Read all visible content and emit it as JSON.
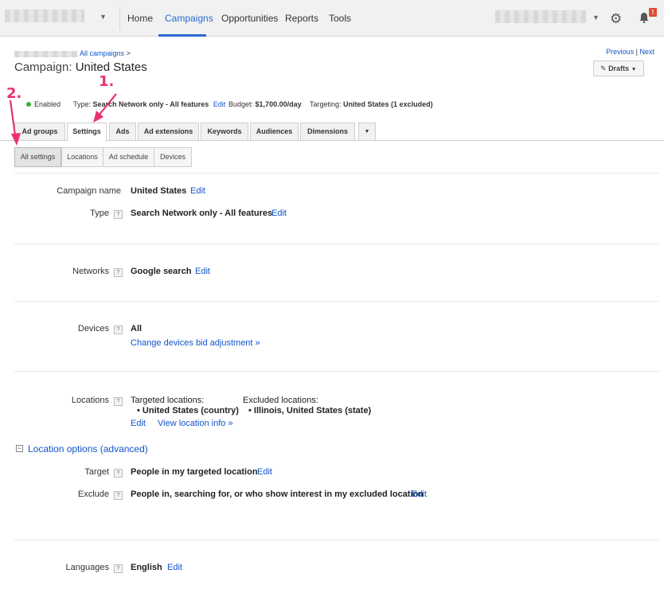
{
  "nav": {
    "items": [
      "Home",
      "Campaigns",
      "Opportunities",
      "Reports",
      "Tools"
    ],
    "active": "Campaigns",
    "notification_badge": "!"
  },
  "header": {
    "breadcrumb_link": "All campaigns",
    "breadcrumb_sep": ">",
    "title_prefix": "Campaign:",
    "title": "United States",
    "previous": "Previous",
    "next": "Next",
    "pager_sep": "|",
    "drafts": "Drafts"
  },
  "status": {
    "state": "Enabled",
    "type_label": "Type:",
    "type_value": "Search Network only - All features",
    "edit": "Edit",
    "budget_label": "Budget:",
    "budget_value": "$1,700.00/day",
    "targeting_label": "Targeting:",
    "targeting_value": "United States (1 excluded)"
  },
  "annotations": {
    "one": "1.",
    "two": "2."
  },
  "tabs": [
    "Ad groups",
    "Settings",
    "Ads",
    "Ad extensions",
    "Keywords",
    "Audiences",
    "Dimensions"
  ],
  "subtabs": [
    "All settings",
    "Locations",
    "Ad schedule",
    "Devices"
  ],
  "settings": {
    "campaign_name_label": "Campaign name",
    "campaign_name_value": "United States",
    "type_label": "Type",
    "type_value": "Search Network only - All features",
    "networks_label": "Networks",
    "networks_value": "Google search",
    "devices_label": "Devices",
    "devices_value": "All",
    "devices_link": "Change devices bid adjustment »",
    "locations_label": "Locations",
    "targeted_heading": "Targeted locations:",
    "targeted_item": "United States (country)",
    "excluded_heading": "Excluded locations:",
    "excluded_item": "Illinois, United States (state)",
    "view_location_info": "View location info »",
    "location_options": "Location options (advanced)",
    "target_label": "Target",
    "target_value": "People in my targeted location",
    "exclude_label": "Exclude",
    "exclude_value": "People in, searching for, or who show interest in my excluded location",
    "languages_label": "Languages",
    "languages_value": "English",
    "edit": "Edit",
    "help": "?"
  }
}
